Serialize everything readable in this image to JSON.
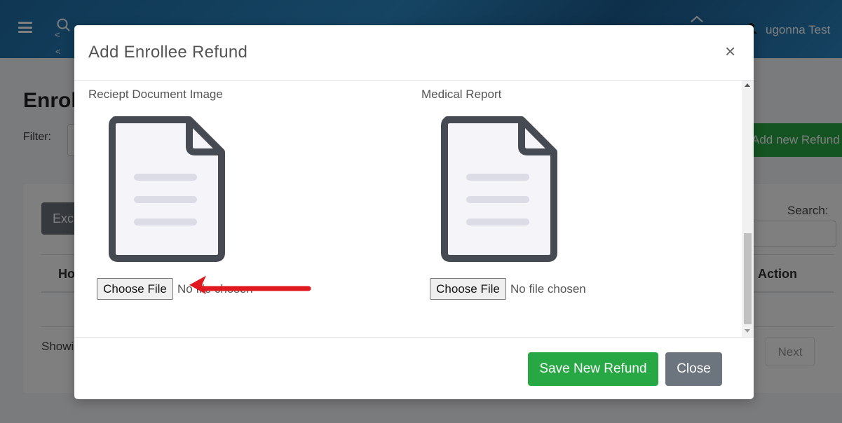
{
  "topbar": {
    "user_name": "ugonna Test",
    "crumb_arrow_1": "<",
    "crumb_arrow_2": "<",
    "icons": [
      "hamburger-icon",
      "search-icon",
      "home-icon",
      "user-icon"
    ]
  },
  "page": {
    "title": "Enrol",
    "filter_label": "Filter:",
    "add_button": "Add new Refund",
    "excel_button": "Exc",
    "search_label": "Search:",
    "table_header_first": "Ho",
    "table_header_action": "Action",
    "showing_text": "Showi",
    "next_button": "Next"
  },
  "modal": {
    "title": "Add Enrollee Refund",
    "close_symbol": "×",
    "fields": [
      {
        "label": "Reciept Document Image",
        "button": "Choose File",
        "status": "No file chosen",
        "icon": "document-icon"
      },
      {
        "label": "Medical Report",
        "button": "Choose File",
        "status": "No file chosen",
        "icon": "document-icon"
      }
    ],
    "save_button": "Save New Refund",
    "close_button": "Close",
    "annotation": "red-arrow-icon"
  },
  "colors": {
    "primary_green": "#28a745",
    "secondary_gray": "#6c757d",
    "annotation_red": "#e0191f",
    "header_blue": "#2b8ac6"
  }
}
